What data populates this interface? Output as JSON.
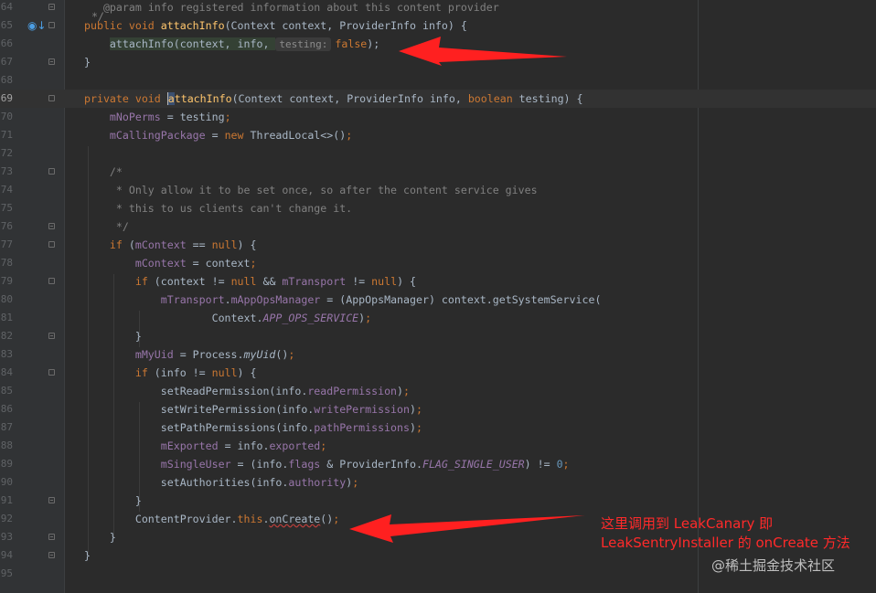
{
  "lines": [
    {
      "n": "64",
      "parts": [
        {
          "t": "   "
        },
        {
          "t": "@param",
          "c": "cmt"
        },
        {
          "t": " info registered information about this content provider",
          "c": "cmt"
        }
      ]
    },
    {
      "n": "65",
      "override": true,
      "parts": [
        {
          "t": "public void ",
          "c": "kw"
        },
        {
          "t": "attachInfo",
          "c": "fn"
        },
        {
          "t": "(Context context, ProviderInfo info) {"
        }
      ]
    },
    {
      "n": "66",
      "parts": [
        {
          "t": "    "
        },
        {
          "t": "attachInfo(context, info, ",
          "c": "stmt"
        },
        {
          "t": "testing:",
          "c": "hint"
        },
        {
          "t": "false",
          "c": "kw"
        },
        {
          "t": ");"
        }
      ]
    },
    {
      "n": "67",
      "parts": [
        {
          "t": "}"
        }
      ]
    },
    {
      "n": "68",
      "parts": []
    },
    {
      "n": "69",
      "current": true,
      "parts": [
        {
          "t": "private void ",
          "c": "kw"
        },
        {
          "t": "a",
          "c": "caret"
        },
        {
          "t": "ttachInfo",
          "c": "fn"
        },
        {
          "t": "(Context context, ProviderInfo info, "
        },
        {
          "t": "boolean",
          "c": "kw"
        },
        {
          "t": " testing) {"
        }
      ]
    },
    {
      "n": "70",
      "parts": [
        {
          "t": "    "
        },
        {
          "t": "mNoPerms",
          "c": "field"
        },
        {
          "t": " = testing"
        },
        {
          "t": ";",
          "c": "kw"
        }
      ]
    },
    {
      "n": "71",
      "parts": [
        {
          "t": "    "
        },
        {
          "t": "mCallingPackage",
          "c": "field"
        },
        {
          "t": " = "
        },
        {
          "t": "new ",
          "c": "kw"
        },
        {
          "t": "ThreadLocal<>()"
        },
        {
          "t": ";",
          "c": "kw"
        }
      ]
    },
    {
      "n": "72",
      "parts": []
    },
    {
      "n": "73",
      "parts": [
        {
          "t": "    /*",
          "c": "cmt"
        }
      ]
    },
    {
      "n": "74",
      "parts": [
        {
          "t": "     * Only allow it to be set once, so after the content service gives",
          "c": "cmt"
        }
      ]
    },
    {
      "n": "75",
      "parts": [
        {
          "t": "     * this to us clients can't change it.",
          "c": "cmt"
        }
      ]
    },
    {
      "n": "76",
      "parts": [
        {
          "t": "     */",
          "c": "cmt"
        }
      ]
    },
    {
      "n": "77",
      "parts": [
        {
          "t": "    "
        },
        {
          "t": "if",
          "c": "kw"
        },
        {
          "t": " ("
        },
        {
          "t": "mContext",
          "c": "field"
        },
        {
          "t": " == "
        },
        {
          "t": "null",
          "c": "kw"
        },
        {
          "t": ") {"
        }
      ]
    },
    {
      "n": "78",
      "parts": [
        {
          "t": "        "
        },
        {
          "t": "mContext",
          "c": "field"
        },
        {
          "t": " = context"
        },
        {
          "t": ";",
          "c": "kw"
        }
      ]
    },
    {
      "n": "79",
      "parts": [
        {
          "t": "        "
        },
        {
          "t": "if",
          "c": "kw"
        },
        {
          "t": " (context != "
        },
        {
          "t": "null",
          "c": "kw"
        },
        {
          "t": " && "
        },
        {
          "t": "mTransport",
          "c": "field"
        },
        {
          "t": " != "
        },
        {
          "t": "null",
          "c": "kw"
        },
        {
          "t": ") {"
        }
      ]
    },
    {
      "n": "80",
      "parts": [
        {
          "t": "            "
        },
        {
          "t": "mTransport",
          "c": "field"
        },
        {
          "t": "."
        },
        {
          "t": "mAppOpsManager",
          "c": "field"
        },
        {
          "t": " = (AppOpsManager) context.getSystemService("
        }
      ]
    },
    {
      "n": "81",
      "parts": [
        {
          "t": "                    Context."
        },
        {
          "t": "APP_OPS_SERVICE",
          "c": "field-i"
        },
        {
          "t": ")"
        },
        {
          "t": ";",
          "c": "kw"
        }
      ]
    },
    {
      "n": "82",
      "parts": [
        {
          "t": "        }"
        }
      ]
    },
    {
      "n": "83",
      "parts": [
        {
          "t": "        "
        },
        {
          "t": "mMyUid",
          "c": "field"
        },
        {
          "t": " = Process."
        },
        {
          "t": "myUid",
          "c": "static-i"
        },
        {
          "t": "()"
        },
        {
          "t": ";",
          "c": "kw"
        }
      ]
    },
    {
      "n": "84",
      "parts": [
        {
          "t": "        "
        },
        {
          "t": "if",
          "c": "kw"
        },
        {
          "t": " (info != "
        },
        {
          "t": "null",
          "c": "kw"
        },
        {
          "t": ") {"
        }
      ]
    },
    {
      "n": "85",
      "parts": [
        {
          "t": "            setReadPermission(info."
        },
        {
          "t": "readPermission",
          "c": "field"
        },
        {
          "t": ")"
        },
        {
          "t": ";",
          "c": "kw"
        }
      ]
    },
    {
      "n": "86",
      "parts": [
        {
          "t": "            setWritePermission(info."
        },
        {
          "t": "writePermission",
          "c": "field"
        },
        {
          "t": ")"
        },
        {
          "t": ";",
          "c": "kw"
        }
      ]
    },
    {
      "n": "87",
      "parts": [
        {
          "t": "            setPathPermissions(info."
        },
        {
          "t": "pathPermissions",
          "c": "field"
        },
        {
          "t": ")"
        },
        {
          "t": ";",
          "c": "kw"
        }
      ]
    },
    {
      "n": "88",
      "parts": [
        {
          "t": "            "
        },
        {
          "t": "mExported",
          "c": "field"
        },
        {
          "t": " = info."
        },
        {
          "t": "exported",
          "c": "field"
        },
        {
          "t": ";",
          "c": "kw"
        }
      ]
    },
    {
      "n": "89",
      "parts": [
        {
          "t": "            "
        },
        {
          "t": "mSingleUser",
          "c": "field"
        },
        {
          "t": " = (info."
        },
        {
          "t": "flags",
          "c": "field"
        },
        {
          "t": " & ProviderInfo."
        },
        {
          "t": "FLAG_SINGLE_USER",
          "c": "field-i"
        },
        {
          "t": ") != "
        },
        {
          "t": "0",
          "c": "num"
        },
        {
          "t": ";",
          "c": "kw"
        }
      ]
    },
    {
      "n": "90",
      "parts": [
        {
          "t": "            setAuthorities(info."
        },
        {
          "t": "authority",
          "c": "field"
        },
        {
          "t": ")"
        },
        {
          "t": ";",
          "c": "kw"
        }
      ]
    },
    {
      "n": "91",
      "parts": [
        {
          "t": "        }"
        }
      ]
    },
    {
      "n": "92",
      "parts": [
        {
          "t": "        ContentProvider."
        },
        {
          "t": "this",
          "c": "kw"
        },
        {
          "t": ".",
          "c": ""
        },
        {
          "t": "onCreate",
          "c": "squiggle"
        },
        {
          "t": "()"
        },
        {
          "t": ";",
          "c": "kw"
        }
      ]
    },
    {
      "n": "93",
      "parts": [
        {
          "t": "    }"
        }
      ]
    },
    {
      "n": "94",
      "parts": [
        {
          "t": "}"
        }
      ]
    },
    {
      "n": "95",
      "parts": []
    }
  ],
  "first_line_comment_tail": "*/",
  "annotation": {
    "line1": "这里调用到 LeakCanary  即",
    "line2": "LeakSentryInstaller 的 onCreate 方法"
  },
  "watermark": "@稀土掘金技术社区",
  "colors": {
    "background": "#2b2b2b",
    "keyword": "#cc7832",
    "function": "#ffc66d",
    "field": "#9876aa",
    "comment": "#808080",
    "arrow": "#ff2020"
  }
}
